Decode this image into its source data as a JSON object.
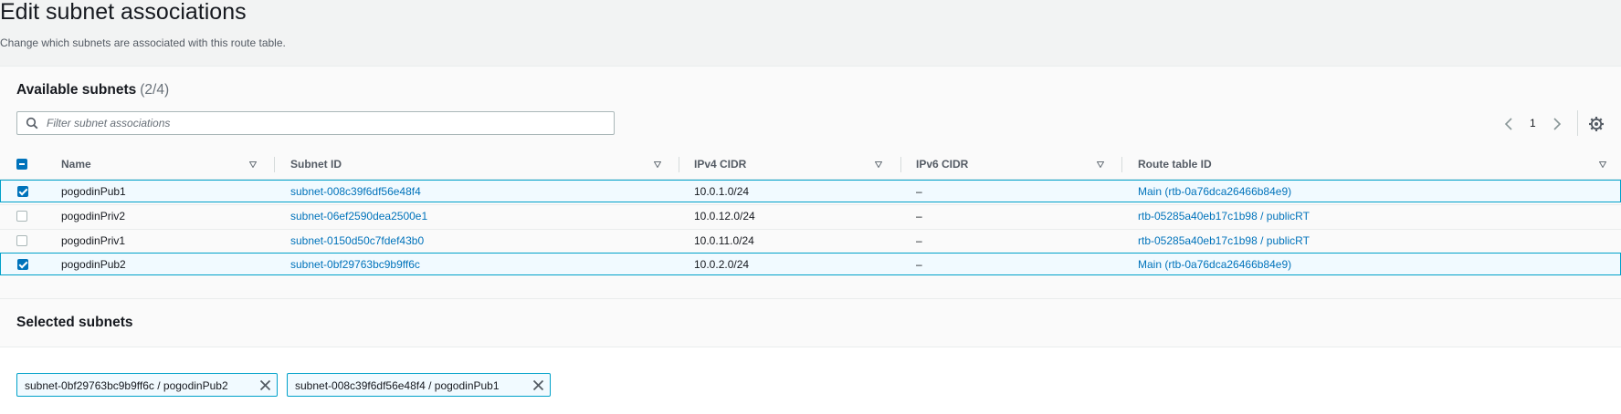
{
  "page": {
    "title": "Edit subnet associations",
    "description": "Change which subnets are associated with this route table."
  },
  "available": {
    "title": "Available subnets",
    "count": "(2/4)",
    "filter_placeholder": "Filter subnet associations",
    "page_number": "1",
    "columns": [
      "Name",
      "Subnet ID",
      "IPv4 CIDR",
      "IPv6 CIDR",
      "Route table ID"
    ],
    "rows": [
      {
        "checked": true,
        "name": "pogodinPub1",
        "subnet_id": "subnet-008c39f6df56e48f4",
        "ipv4": "10.0.1.0/24",
        "ipv6": "–",
        "route_table": "Main (rtb-0a76dca26466b84e9)"
      },
      {
        "checked": false,
        "name": "pogodinPriv2",
        "subnet_id": "subnet-06ef2590dea2500e1",
        "ipv4": "10.0.12.0/24",
        "ipv6": "–",
        "route_table": "rtb-05285a40eb17c1b98 / publicRT"
      },
      {
        "checked": false,
        "name": "pogodinPriv1",
        "subnet_id": "subnet-0150d50c7fdef43b0",
        "ipv4": "10.0.11.0/24",
        "ipv6": "–",
        "route_table": "rtb-05285a40eb17c1b98 / publicRT"
      },
      {
        "checked": true,
        "name": "pogodinPub2",
        "subnet_id": "subnet-0bf29763bc9b9ff6c",
        "ipv4": "10.0.2.0/24",
        "ipv6": "–",
        "route_table": "Main (rtb-0a76dca26466b84e9)"
      }
    ]
  },
  "selected": {
    "title": "Selected subnets",
    "tokens": [
      "subnet-0bf29763bc9b9ff6c / pogodinPub2",
      "subnet-008c39f6df56e48f4 / pogodinPub1"
    ]
  },
  "icons": {
    "search": "search-icon",
    "prev": "chevron-left-icon",
    "next": "chevron-right-icon",
    "settings": "gear-icon",
    "sort": "sort-down-icon",
    "dismiss": "close-icon"
  },
  "colors": {
    "link": "#0073bb",
    "selected_border": "#00a1c9",
    "selected_bg": "#f1faff",
    "checkbox": "#0073bb"
  }
}
